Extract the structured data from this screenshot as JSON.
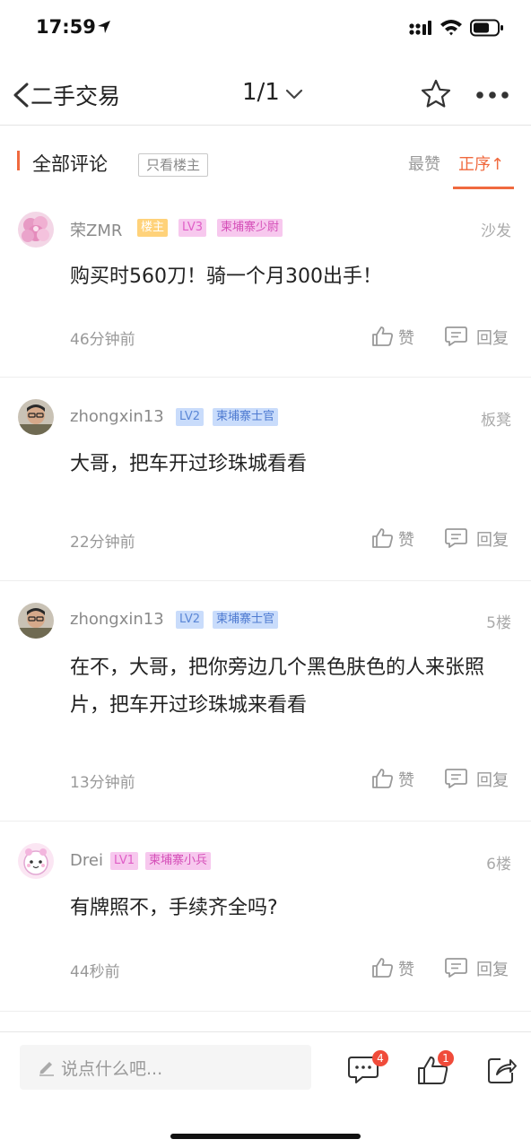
{
  "status_bar": {
    "time": "17:59"
  },
  "nav": {
    "back_label": "二手交易",
    "title": "1/1"
  },
  "filter": {
    "title": "全部评论",
    "op_only": "只看楼主",
    "sort_best": "最赞",
    "sort_order": "正序↑"
  },
  "comments": [
    {
      "username": "荣ZMR",
      "badges": [
        "楼主",
        "LV3",
        "柬埔寨少尉"
      ],
      "floor": "沙发",
      "content": "购买时560刀！骑一个月300出手！",
      "time": "46分钟前",
      "like_label": "赞",
      "reply_label": "回复"
    },
    {
      "username": "zhongxin13",
      "badges": [
        "LV2",
        "柬埔寨士官"
      ],
      "floor": "板凳",
      "content": "大哥，把车开过珍珠城看看",
      "time": "22分钟前",
      "like_label": "赞",
      "reply_label": "回复"
    },
    {
      "username": "zhongxin13",
      "badges": [
        "LV2",
        "柬埔寨士官"
      ],
      "floor": "5楼",
      "content": "在不，大哥，把你旁边几个黑色肤色的人来张照片，把车开过珍珠城来看看",
      "time": "13分钟前",
      "like_label": "赞",
      "reply_label": "回复"
    },
    {
      "username": "Drei",
      "badges": [
        "LV1",
        "柬埔寨小兵"
      ],
      "floor": "6楼",
      "content": "有牌照不，手续齐全吗?",
      "time": "44秒前",
      "like_label": "赞",
      "reply_label": "回复"
    }
  ],
  "bottom_bar": {
    "input_placeholder": "说点什么吧...",
    "comment_count": "4",
    "like_count": "1"
  },
  "colors": {
    "accent": "#f06a3f",
    "badge_red": "#f04b3a",
    "text_gray": "#999999"
  },
  "icons": [
    "location-arrow-icon",
    "signal-icon",
    "wifi-icon",
    "battery-icon",
    "back-chevron-icon",
    "chevron-down-icon",
    "star-icon",
    "more-icon",
    "thumbs-up-icon",
    "reply-bubble-icon",
    "pen-icon",
    "comments-icon",
    "share-icon"
  ]
}
